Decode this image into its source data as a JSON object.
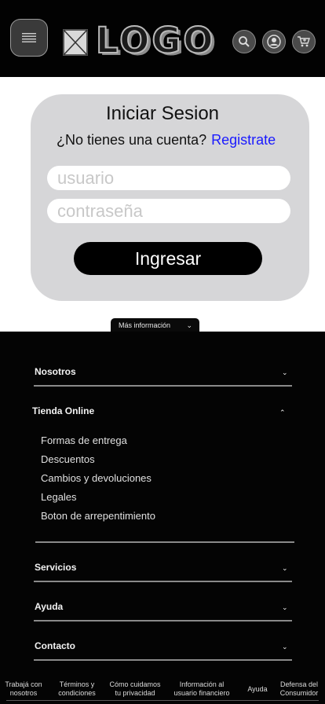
{
  "header": {
    "menu_icon": "hamburger-menu-icon",
    "logo_text": "LOGO",
    "icons": [
      "search-icon",
      "user-icon",
      "cart-icon"
    ]
  },
  "login": {
    "title": "Iniciar Sesion",
    "signup_prompt": "¿No tienes una cuenta?",
    "signup_link": "Registrate",
    "username_placeholder": "usuario",
    "password_placeholder": "contraseña",
    "submit_label": "Ingresar"
  },
  "more_info": {
    "label": "Más información",
    "chevron": "⌄"
  },
  "footer": {
    "sections": [
      {
        "title": "Nosotros",
        "chevron": "⌄"
      },
      {
        "title": "Tienda Online",
        "chevron": "⌃"
      },
      {
        "title": "Servicios",
        "chevron": "⌄"
      },
      {
        "title": "Ayuda",
        "chevron": "⌄"
      },
      {
        "title": "Contacto",
        "chevron": "⌄"
      }
    ],
    "tienda_items": [
      "Formas de entrega",
      "Descuentos",
      "Cambios y devoluciones",
      "Legales",
      "Boton de arrepentimiento"
    ],
    "bottom_links": [
      {
        "line1": "Trabajá con",
        "line2": "nosotros"
      },
      {
        "line1": "Términos y",
        "line2": "condiciones"
      },
      {
        "line1": "Cómo cuidamos",
        "line2": "tu privacidad"
      },
      {
        "line1": "Información al",
        "line2": "usuario financiero"
      },
      {
        "line1": "Ayuda",
        "line2": ""
      },
      {
        "line1": "Defensa del",
        "line2": "Consumidor"
      }
    ]
  },
  "colors": {
    "header_bg": "#020202",
    "card_bg": "#d6d6d8",
    "link": "#1a1aff",
    "footer_bg": "#040404"
  }
}
